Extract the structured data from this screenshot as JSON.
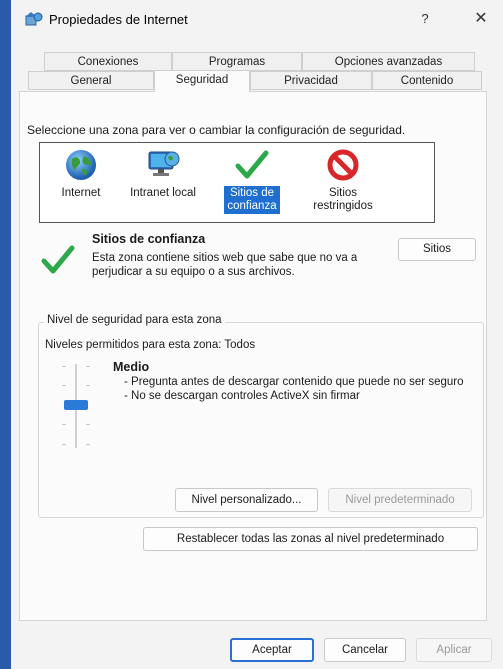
{
  "window": {
    "title": "Propiedades de Internet",
    "help": "?",
    "close": "✕"
  },
  "tabs_row1": [
    "Conexiones",
    "Programas",
    "Opciones avanzadas"
  ],
  "tabs_row2": [
    "General",
    "Seguridad",
    "Privacidad",
    "Contenido"
  ],
  "active_tab": "Seguridad",
  "security": {
    "instruction": "Seleccione una zona para ver o cambiar la configuración de seguridad.",
    "zones": [
      {
        "label": "Internet",
        "icon": "globe-icon"
      },
      {
        "label": "Intranet local",
        "icon": "network-computer-icon"
      },
      {
        "label": "Sitios de confianza",
        "icon": "check-icon",
        "selected": true
      },
      {
        "label": "Sitios restringidos",
        "icon": "forbidden-icon"
      }
    ],
    "selected_zone": {
      "title": "Sitios de confianza",
      "description": "Esta zona contiene sitios web que sabe que no va a perjudicar a su equipo o a sus archivos.",
      "sites_button": "Sitios"
    },
    "level_group_label": "Nivel de seguridad para esta zona",
    "allowed_levels": "Niveles permitidos para esta zona: Todos",
    "level_name": "Medio",
    "level_points": [
      "- Pregunta antes de descargar contenido que puede no ser seguro",
      "- No se descargan controles ActiveX sin firmar"
    ],
    "custom_level_button": "Nivel personalizado...",
    "default_level_button": "Nivel predeterminado",
    "reset_all_button": "Restablecer todas las zonas al nivel predeterminado"
  },
  "footer": {
    "ok": "Aceptar",
    "cancel": "Cancelar",
    "apply": "Aplicar"
  },
  "colors": {
    "accent": "#1e6fd0",
    "check_green": "#2aa84a",
    "forbidden_red": "#d9262b"
  }
}
